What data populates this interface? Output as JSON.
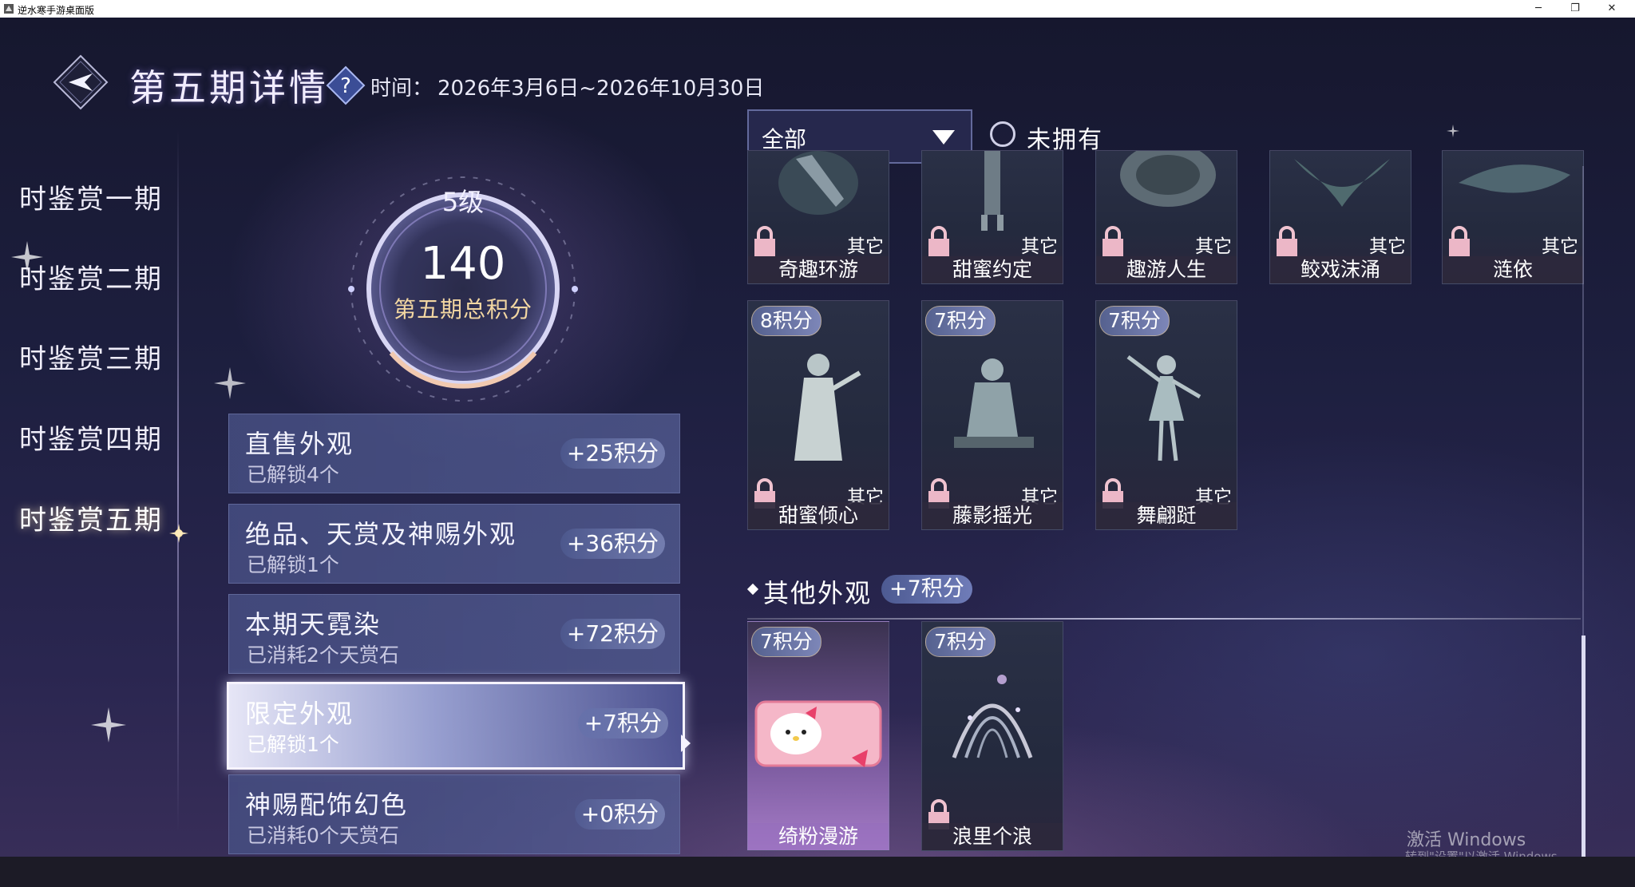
{
  "window": {
    "title": "逆水寒手游桌面版",
    "minimize": "─",
    "maximize": "❐",
    "close": "✕"
  },
  "header": {
    "title": "第五期详情",
    "help_icon": "question-mark-icon",
    "time_label": "时间：",
    "time_value": "2026年3月6日~2026年10月30日"
  },
  "sidebar": {
    "items": [
      {
        "label": "时鉴赏一期",
        "active": false
      },
      {
        "label": "时鉴赏二期",
        "active": false
      },
      {
        "label": "时鉴赏三期",
        "active": false
      },
      {
        "label": "时鉴赏四期",
        "active": false
      },
      {
        "label": "时鉴赏五期",
        "active": true
      }
    ]
  },
  "summary": {
    "level": "5级",
    "total_points": "140",
    "total_label": "第五期总积分"
  },
  "categories": [
    {
      "title": "直售外观",
      "sub": "已解锁4个",
      "points": "+25积分",
      "selected": false
    },
    {
      "title": "绝品、天赏及神赐外观",
      "sub": "已解锁1个",
      "points": "+36积分",
      "selected": false
    },
    {
      "title": "本期天霓染",
      "sub": "已消耗2个天赏石",
      "points": "+72积分",
      "selected": false
    },
    {
      "title": "限定外观",
      "sub": "已解锁1个",
      "points": "+7积分",
      "selected": true
    },
    {
      "title": "神赐配饰幻色",
      "sub": "已消耗0个天赏石",
      "points": "+0积分",
      "selected": false
    }
  ],
  "filter": {
    "dropdown_value": "全部",
    "checkbox_label": "未拥有",
    "checked": false
  },
  "items_row1": [
    {
      "name": "奇趣环游",
      "category": "其它",
      "locked": true
    },
    {
      "name": "甜蜜约定",
      "category": "其它",
      "locked": true
    },
    {
      "name": "趣游人生",
      "category": "其它",
      "locked": true
    },
    {
      "name": "鲛戏沫涌",
      "category": "其它",
      "locked": true
    },
    {
      "name": "涟依",
      "category": "其它",
      "locked": true
    }
  ],
  "items_row2": [
    {
      "name": "甜蜜倾心",
      "category": "其它",
      "points": "8积分",
      "locked": true
    },
    {
      "name": "藤影摇光",
      "category": "其它",
      "points": "7积分",
      "locked": true
    },
    {
      "name": "舞翩跹",
      "category": "其它",
      "points": "7积分",
      "locked": true
    }
  ],
  "other_section": {
    "title": "其他外观",
    "points": "+7积分",
    "items": [
      {
        "name": "绮粉漫游",
        "points": "7积分",
        "locked": false
      },
      {
        "name": "浪里个浪",
        "points": "7积分",
        "locked": true
      }
    ]
  },
  "watermark": {
    "line1": "激活 Windows",
    "line2": "转到\"设置\"以激活 Windows。"
  },
  "colors": {
    "accent_gold": "#f3d7a2",
    "panel_blue": "#4d5a92",
    "lock_pink": "#e9b9c8"
  }
}
